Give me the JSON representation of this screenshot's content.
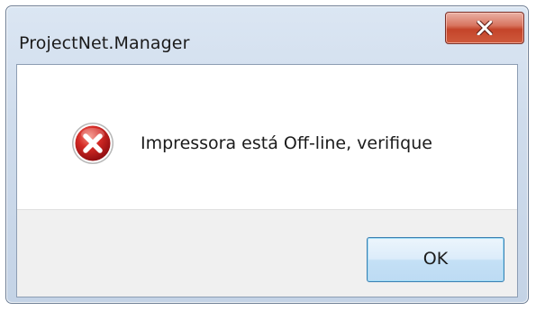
{
  "window": {
    "title": "ProjectNet.Manager",
    "close_icon": "close-x-icon"
  },
  "dialog": {
    "icon": "error-icon",
    "message": "Impressora está Off-line, verifique",
    "ok_label": "OK"
  },
  "colors": {
    "close_button": "#c4442a",
    "error_icon": "#c0171b",
    "ok_border": "#3c7fb1"
  }
}
